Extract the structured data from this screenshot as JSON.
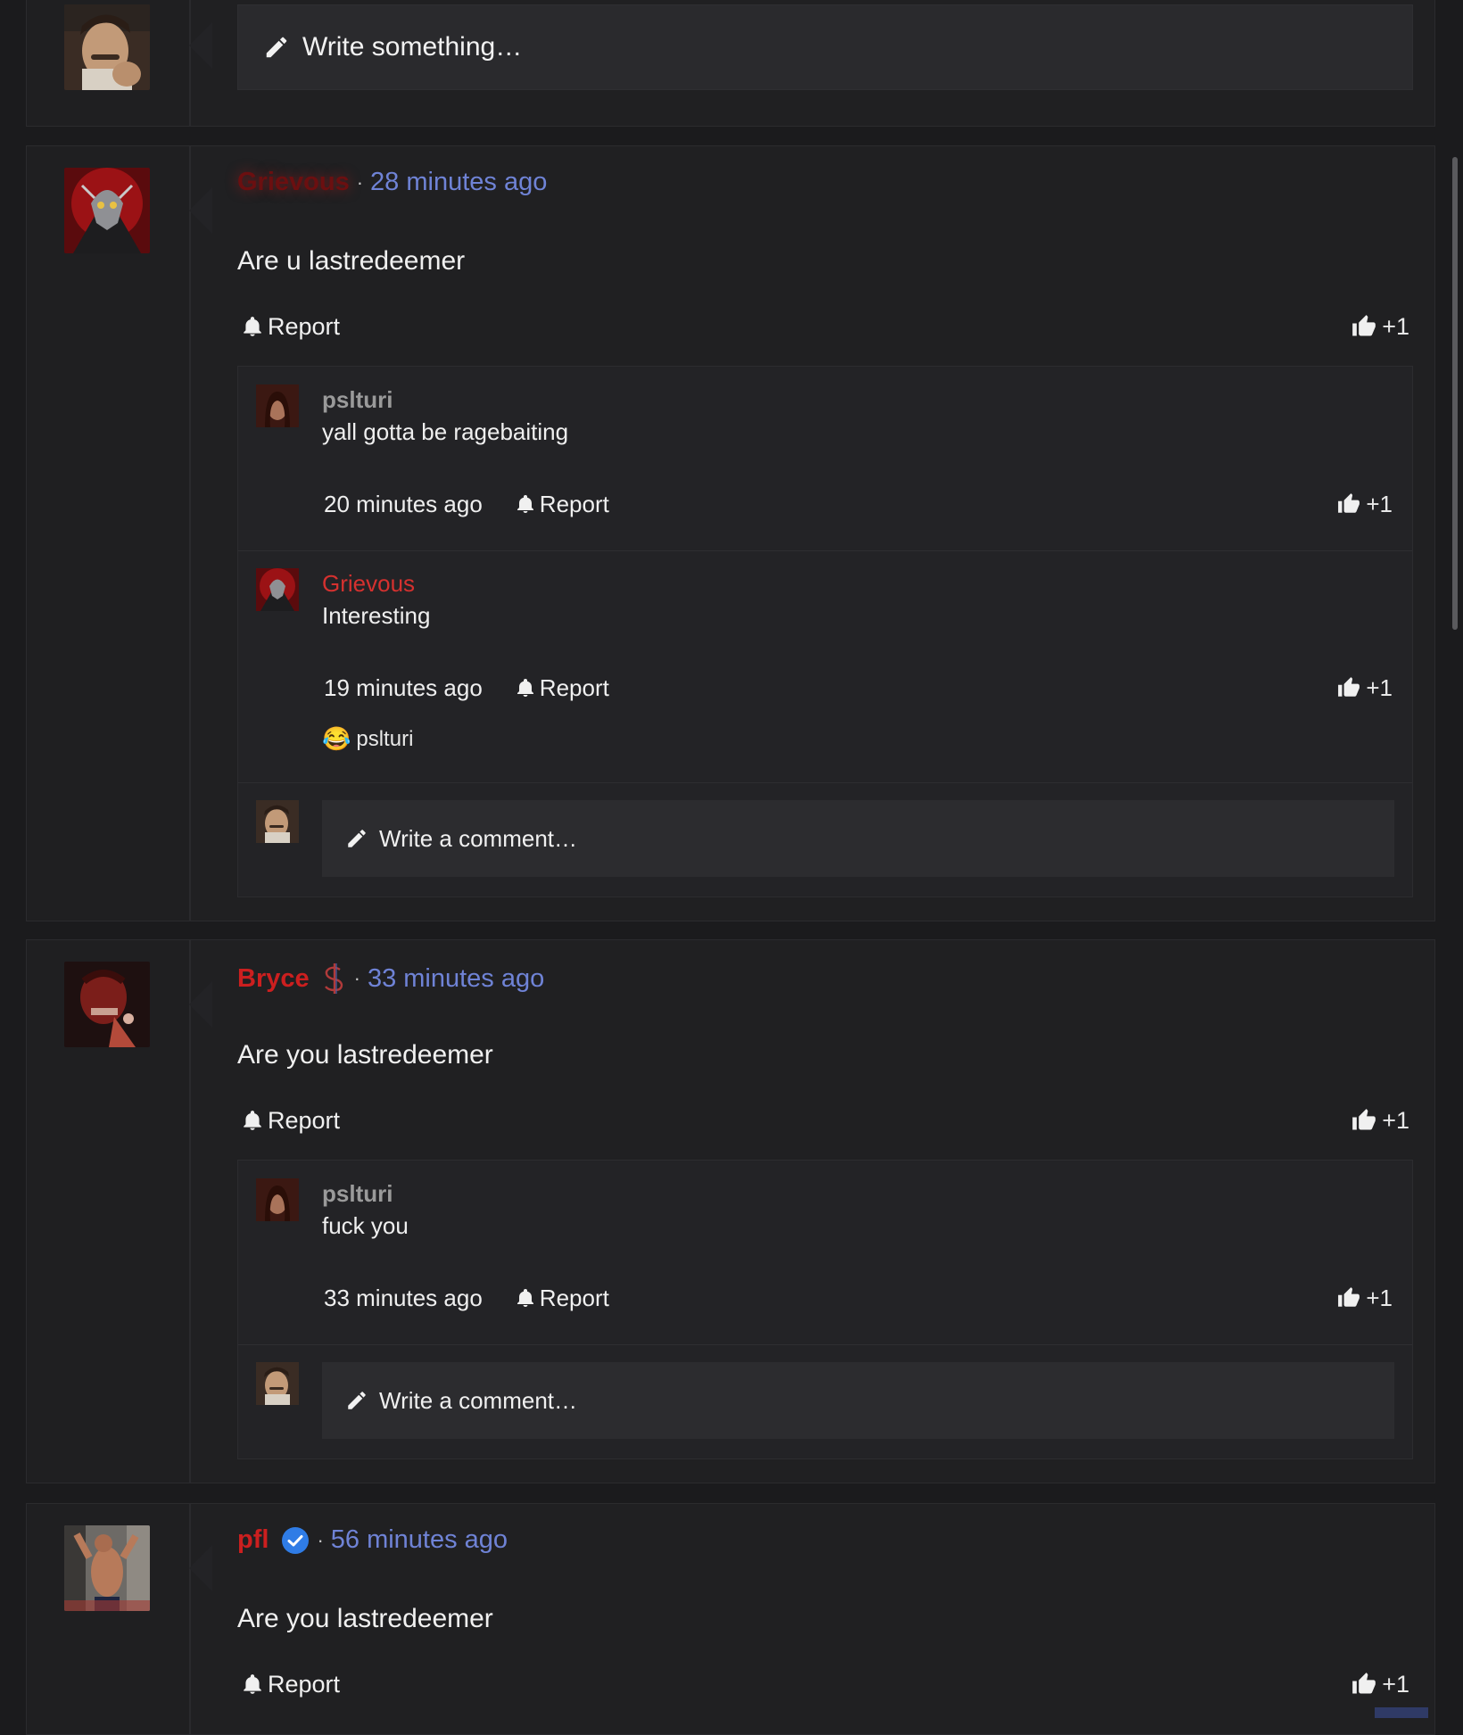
{
  "top_composer": {
    "placeholder": "Write something…"
  },
  "posts": [
    {
      "author": "Grievous",
      "time": "28 minutes ago",
      "text": "Are u lastredeemer",
      "report": "Report",
      "like": "+1",
      "replies": [
        {
          "author": "pslturi",
          "text": "yall gotta be ragebaiting",
          "time": "20 minutes ago",
          "report": "Report",
          "like": "+1"
        },
        {
          "author": "Grievous",
          "text": "Interesting",
          "time": "19 minutes ago",
          "report": "Report",
          "like": "+1",
          "reaction": {
            "emoji": "😂",
            "user": "pslturi"
          }
        }
      ],
      "comment_placeholder": "Write a comment…"
    },
    {
      "author": "Bryce",
      "badge": "$",
      "time": "33 minutes ago",
      "text": "Are you lastredeemer",
      "report": "Report",
      "like": "+1",
      "replies": [
        {
          "author": "pslturi",
          "text": "fuck you",
          "time": "33 minutes ago",
          "report": "Report",
          "like": "+1"
        }
      ],
      "comment_placeholder": "Write a comment…"
    },
    {
      "author": "pfl",
      "verified": true,
      "time": "56 minutes ago",
      "text": "Are you lastredeemer",
      "report": "Report",
      "like": "+1"
    }
  ],
  "separator": "·",
  "colors": {
    "timestamp": "#6f83d6",
    "username_red": "#cc1f1f",
    "background": "#1b1b1d"
  }
}
